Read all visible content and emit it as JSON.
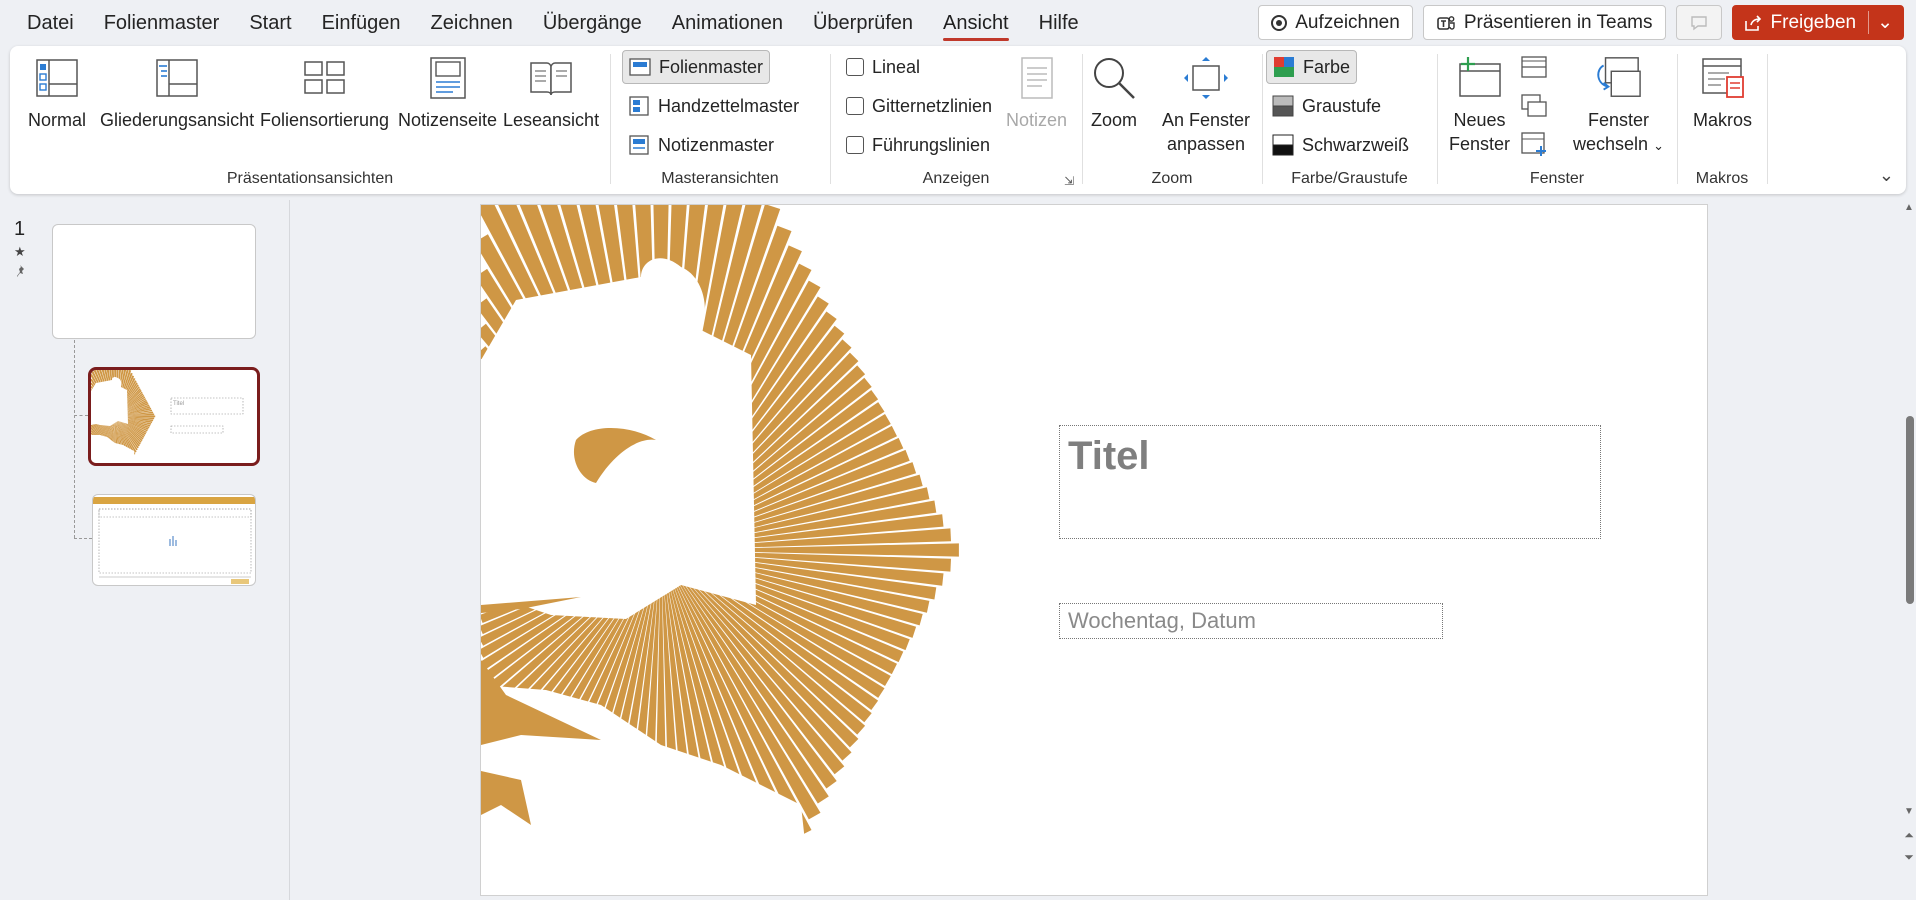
{
  "menu": {
    "tabs": [
      {
        "label": "Datei"
      },
      {
        "label": "Folienmaster"
      },
      {
        "label": "Start"
      },
      {
        "label": "Einfügen"
      },
      {
        "label": "Zeichnen"
      },
      {
        "label": "Übergänge"
      },
      {
        "label": "Animationen"
      },
      {
        "label": "Überprüfen"
      },
      {
        "label": "Ansicht",
        "active": true
      },
      {
        "label": "Hilfe"
      }
    ],
    "record_label": "Aufzeichnen",
    "teams_label": "Präsentieren in Teams",
    "share_label": "Freigeben",
    "share_color": "#c4341a"
  },
  "ribbon": {
    "groups": {
      "presentation_views": {
        "label": "Präsentationsansichten",
        "normal": "Normal",
        "outline": "Gliederungsansicht",
        "sorter": "Foliensortierung",
        "notes_page": "Notizenseite",
        "reading": "Leseansicht"
      },
      "master_views": {
        "label": "Masteransichten",
        "slide_master": "Folienmaster",
        "handout_master": "Handzettelmaster",
        "notes_master": "Notizenmaster"
      },
      "show": {
        "label": "Anzeigen",
        "ruler": "Lineal",
        "gridlines": "Gitternetzlinien",
        "guides": "Führungslinien",
        "notes": "Notizen"
      },
      "zoom": {
        "label": "Zoom",
        "zoom": "Zoom",
        "fit_line1": "An Fenster",
        "fit_line2": "anpassen"
      },
      "color": {
        "label": "Farbe/Graustufe",
        "color": "Farbe",
        "grayscale": "Graustufe",
        "bw": "Schwarzweiß"
      },
      "window": {
        "label": "Fenster",
        "new_line1": "Neues",
        "new_line2": "Fenster",
        "switch_line1": "Fenster",
        "switch_line2": "wechseln"
      },
      "macros": {
        "label": "Makros",
        "macros": "Makros"
      }
    }
  },
  "thumbnails": {
    "slide_number": "1"
  },
  "slide": {
    "title_placeholder": "Titel",
    "date_placeholder": "Wochentag, Datum",
    "accent_color": "#cf9745"
  }
}
